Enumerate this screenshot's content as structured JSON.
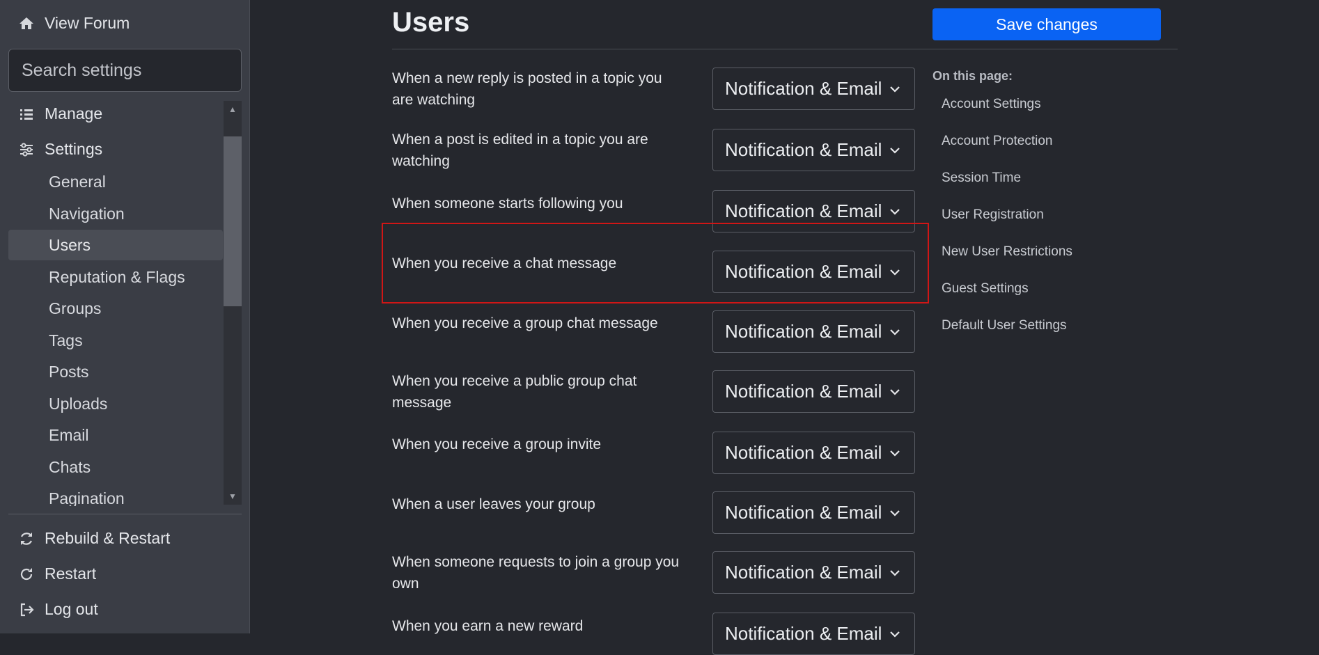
{
  "sidebar": {
    "view_forum": "View Forum",
    "search_placeholder": "Search settings",
    "manage": "Manage",
    "settings": "Settings",
    "items": [
      {
        "label": "General"
      },
      {
        "label": "Navigation"
      },
      {
        "label": "Users",
        "active": true
      },
      {
        "label": "Reputation & Flags"
      },
      {
        "label": "Groups"
      },
      {
        "label": "Tags"
      },
      {
        "label": "Posts"
      },
      {
        "label": "Uploads"
      },
      {
        "label": "Email"
      },
      {
        "label": "Chats"
      },
      {
        "label": "Pagination"
      }
    ],
    "rebuild": "Rebuild & Restart",
    "restart": "Restart",
    "logout": "Log out"
  },
  "main": {
    "title": "Users",
    "save_label": "Save changes",
    "rows": [
      {
        "label": "When a new reply is posted in a topic you are watching",
        "value": "Notification & Email"
      },
      {
        "label": "When a post is edited in a topic you are watching",
        "value": "Notification & Email"
      },
      {
        "label": "When someone starts following you",
        "value": "Notification & Email"
      },
      {
        "label": "When you receive a chat message",
        "value": "Notification & Email"
      },
      {
        "label": "When you receive a group chat message",
        "value": "Notification & Email"
      },
      {
        "label": "When you receive a public group chat message",
        "value": "Notification & Email"
      },
      {
        "label": "When you receive a group invite",
        "value": "Notification & Email"
      },
      {
        "label": "When a user leaves your group",
        "value": "Notification & Email"
      },
      {
        "label": "When someone requests to join a group you own",
        "value": "Notification & Email"
      },
      {
        "label": "When you earn a new reward",
        "value": "Notification & Email"
      }
    ]
  },
  "on_this_page": {
    "title": "On this page:",
    "links": [
      "Account Settings",
      "Account Protection",
      "Session Time",
      "User Registration",
      "New User Restrictions",
      "Guest Settings",
      "Default User Settings"
    ]
  },
  "colors": {
    "accent": "#0a63f3",
    "highlight_border": "#d01616",
    "background": "#25272d",
    "sidebar": "#3a3d45"
  }
}
